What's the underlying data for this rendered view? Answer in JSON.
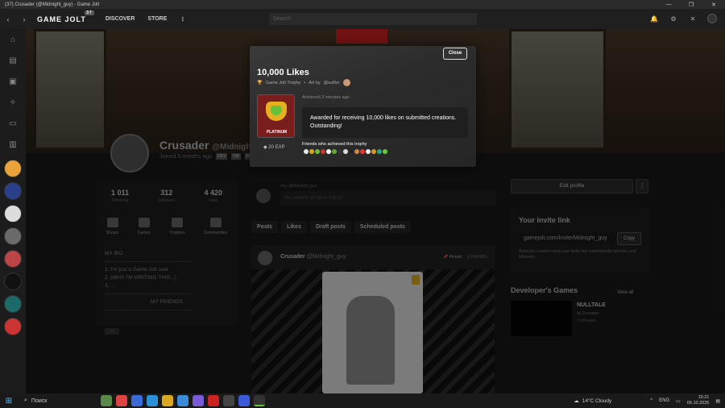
{
  "window": {
    "title": "(37) Crusader (@Midnight_guy) - Game Jolt"
  },
  "topbar": {
    "logo": "GAME JOLT",
    "logo_badge": "37",
    "nav": [
      "DISCOVER",
      "STORE"
    ],
    "search_placeholder": "Search"
  },
  "profile": {
    "name": "Crusader",
    "handle": "@Midnight_g",
    "joined": "Joined 5 months ago",
    "tags": [
      "DEV",
      "FM",
      "FM"
    ],
    "stats": [
      {
        "value": "1 011",
        "label": "Following"
      },
      {
        "value": "312",
        "label": "Followers"
      },
      {
        "value": "4 420",
        "label": "Likes"
      }
    ],
    "tiles": [
      "Shouts",
      "Games",
      "Trophies",
      "Communities"
    ],
    "bio_title": "MY BIO",
    "bio_lines": [
      "1. I'm just a Game Jolt user",
      "2. (WHY I'M WRITING THIS...)",
      "3. ..."
    ],
    "my_friends": "MY FRIENDS",
    "more": "..."
  },
  "composer": {
    "hint": "Hey @Midnight_guy",
    "placeholder": "So, what's on your mind?"
  },
  "tabs": [
    "Posts",
    "Likes",
    "Draft posts",
    "Scheduled posts"
  ],
  "post": {
    "name": "Crusader",
    "handle": "@Midnight_guy",
    "pinned": "Pinned",
    "ago": "3 months"
  },
  "right": {
    "edit_profile": "Edit profile",
    "invite_title": "Your invite link",
    "invite_url": "gamejolt.com/invite/Midnight_guy",
    "copy": "Copy",
    "invite_note": "Accounts created using your invite link automatically become your followers.",
    "dev_title": "Developer's Games",
    "view_all": "View all",
    "game_title": "NULLTALE",
    "game_by": "by Crusader",
    "game_followers": "2 followers"
  },
  "modal": {
    "close": "Close",
    "title": "10,000 Likes",
    "trophy_type": "Game Jolt Trophy",
    "art_by": "Art by",
    "artist": "@sulfizr",
    "achieved": "Achieved 3 minutes ago",
    "description": "Awarded for receiving 10,000 likes on submitted creations. Outstanding!",
    "platinum": "PLATINUM",
    "exp": "20 EXP",
    "friends_title": "Friends who achieved this trophy"
  },
  "taskbar": {
    "search": "Поиск",
    "weather": "14°C Cloudy",
    "lang": "ENG",
    "time": "15:21",
    "date": "05.10.2025"
  },
  "colors": {
    "accent": "#e6b020",
    "trophy_bg": "#7a1d1d",
    "banner_red": "#cc2222"
  }
}
